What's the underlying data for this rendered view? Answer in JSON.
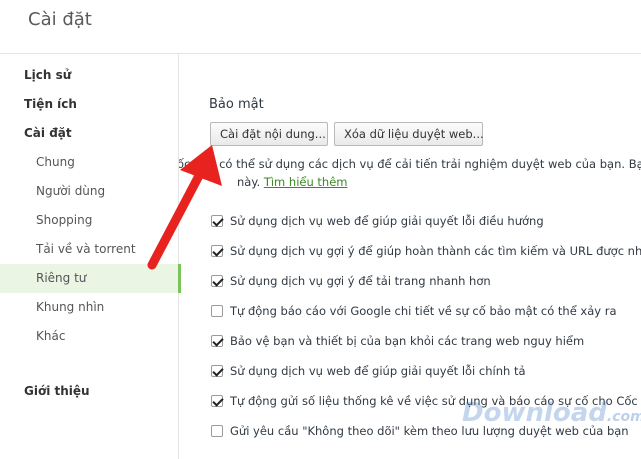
{
  "header": {
    "title": "Cài đặt"
  },
  "sidebar": {
    "items": [
      {
        "label": "Lịch sử",
        "level": "top"
      },
      {
        "label": "Tiện ích",
        "level": "top"
      },
      {
        "label": "Cài đặt",
        "level": "top"
      },
      {
        "label": "Chung",
        "level": "sub"
      },
      {
        "label": "Người dùng",
        "level": "sub"
      },
      {
        "label": "Shopping",
        "level": "sub"
      },
      {
        "label": "Tải về và torrent",
        "level": "sub"
      },
      {
        "label": "Riêng tư",
        "level": "sub",
        "selected": true
      },
      {
        "label": "Khung nhìn",
        "level": "sub"
      },
      {
        "label": "Khác",
        "level": "sub"
      },
      {
        "label": "Giới thiệu",
        "level": "top"
      }
    ]
  },
  "privacy": {
    "title": "Bảo mật",
    "content_settings_button": "Cài đặt nội dung...",
    "clear_data_button": "Xóa dữ liệu duyệt web...",
    "description": "Cốc Cốc có thể sử dụng các dịch vụ để cải tiến trải nghiệm duyệt web của bạn. Bạ",
    "description_suffix": "này.",
    "learn_more": "Tìm hiểu thêm",
    "options": [
      {
        "label": "Sử dụng dịch vụ web để giúp giải quyết lỗi điều hướng",
        "checked": true
      },
      {
        "label": "Sử dụng dịch vụ gợi ý để giúp hoàn thành các tìm kiếm và URL được nhập tro",
        "checked": true
      },
      {
        "label": "Sử dụng dịch vụ gợi ý để tải trang nhanh hơn",
        "checked": true
      },
      {
        "label": "Tự động báo cáo với Google chi tiết về sự cố bảo mật có thể xảy ra",
        "checked": false
      },
      {
        "label": "Bảo vệ bạn và thiết bị của bạn khỏi các trang web nguy hiểm",
        "checked": true
      },
      {
        "label": "Sử dụng dịch vụ web để giúp giải quyết lỗi chính tả",
        "checked": true
      },
      {
        "label": "Tự động gửi số liệu thống kê về việc sử dụng và báo cáo sự cố cho Cốc Cốc",
        "checked": true
      },
      {
        "label": "Gửi yêu cầu \"Không theo dõi\" kèm theo lưu lượng duyệt web của bạn",
        "checked": false
      }
    ]
  },
  "watermark": {
    "text": "Download",
    "suffix": ".com.vn"
  },
  "colors": {
    "accent": "#7cc35b",
    "link": "#3a8a23",
    "arrow": "#e8231f"
  }
}
